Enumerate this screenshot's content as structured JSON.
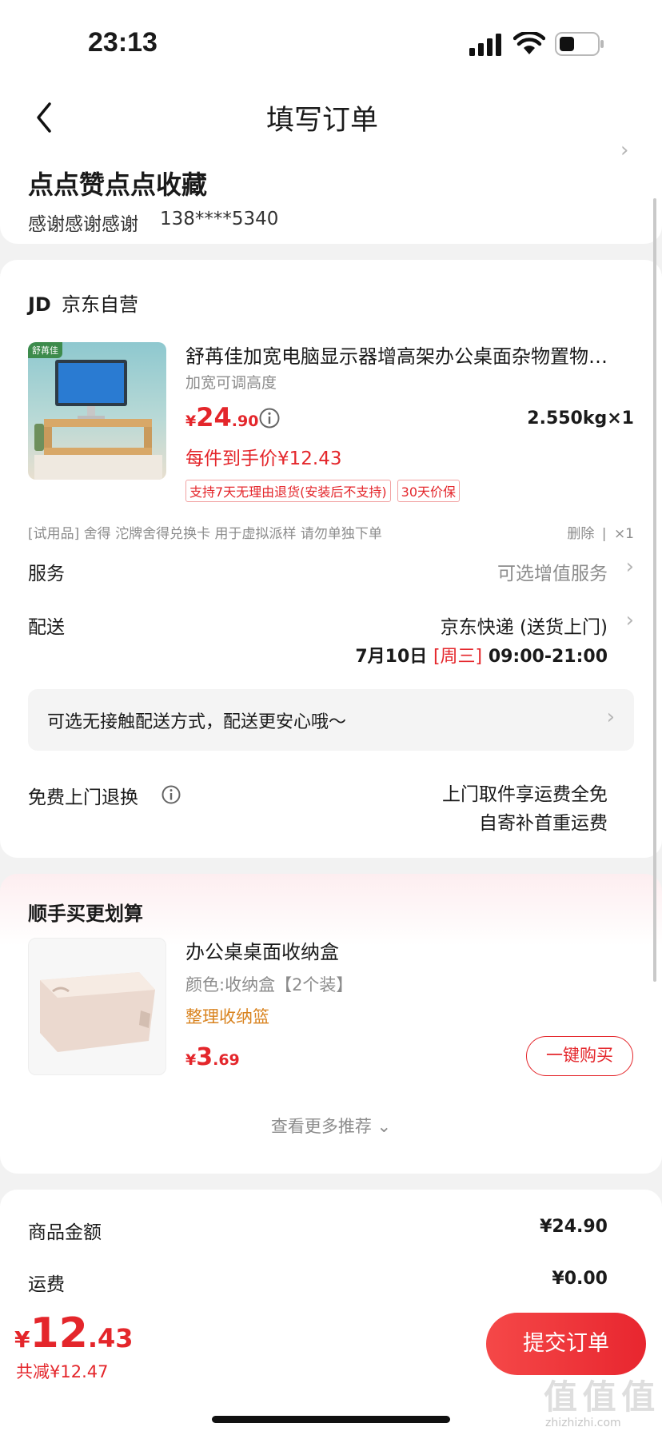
{
  "status_bar": {
    "time": "23:13"
  },
  "header": {
    "title": "填写订单"
  },
  "address": {
    "name": "点点赞点点收藏",
    "recipient": "感谢感谢感谢",
    "phone": "138****5340"
  },
  "shop": {
    "logo": "JD",
    "name": "京东自营"
  },
  "product": {
    "brand_tag": "舒苒佳",
    "title": "舒苒佳加宽电脑显示器增高架办公桌面杂物置物…",
    "spec": "加宽可调高度",
    "price_symbol": "¥",
    "price_int": "24",
    "price_dec": ".90",
    "weight_qty": "2.550kg×1",
    "unit_price": "每件到手价¥12.43",
    "tags": [
      "支持7天无理由退货(安装后不支持)",
      "30天价保"
    ]
  },
  "trial": {
    "text": "[试用品] 舍得 沱牌舍得兑换卡 用于虚拟派样 请勿单独下单",
    "delete": "删除",
    "sep": "|",
    "qty": "×1"
  },
  "service": {
    "label": "服务",
    "value": "可选增值服务"
  },
  "delivery": {
    "label": "配送",
    "method": "京东快递 (送货上门)",
    "date": "7月10日",
    "weekday": "[周三]",
    "time": "09:00-21:00"
  },
  "contactless": {
    "text": "可选无接触配送方式，配送更安心哦～"
  },
  "free_return": {
    "label": "免费上门退换",
    "line1": "上门取件享运费全免",
    "line2": "自寄补首重运费"
  },
  "recommend": {
    "title": "顺手买更划算",
    "item_name": "办公桌桌面收纳盒",
    "item_spec": "颜色:收纳盒【2个装】",
    "item_tag": "整理收纳篮",
    "price_symbol": "¥",
    "price_int": "3",
    "price_dec": ".69",
    "buy_button": "一键购买",
    "more": "查看更多推荐"
  },
  "summary": {
    "goods_label": "商品金额",
    "goods_value": "¥24.90",
    "shipping_label": "运费",
    "shipping_value": "¥0.00"
  },
  "bottom": {
    "price_symbol": "¥",
    "price_int": "12",
    "price_dec": ".43",
    "discount": "共减¥12.47",
    "submit": "提交订单"
  },
  "watermark": {
    "text": "值 值 值",
    "url": "zhizhizhi.com"
  },
  "colors": {
    "accent": "#e4262b",
    "orange": "#d9831f",
    "bg": "#f2f2f2"
  }
}
